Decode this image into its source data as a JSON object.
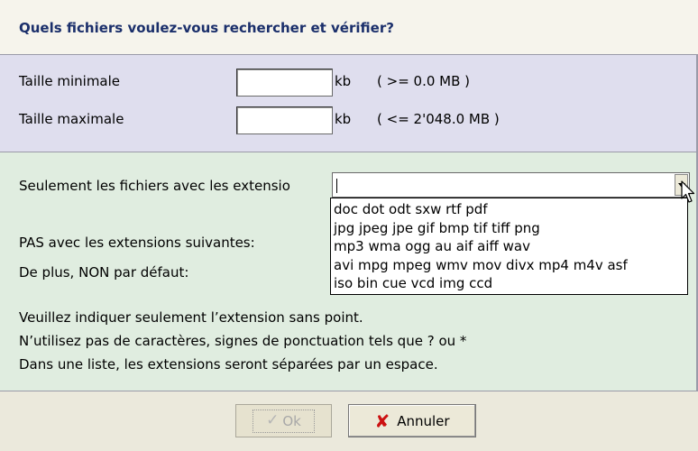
{
  "header": {
    "title": "Quels fichiers voulez-vous rechercher et vérifier?"
  },
  "size": {
    "min_label": "Taille minimale",
    "min_value": "",
    "min_unit": "kb",
    "min_hint": "( >= 0.0 MB )",
    "max_label": "Taille maximale",
    "max_value": "",
    "max_unit": "kb",
    "max_hint": "( <= 2'048.0 MB )"
  },
  "extensions": {
    "only_label": "Seulement les fichiers avec les extensio",
    "only_value": "",
    "not_label": "PAS avec les extensions suivantes:",
    "default_label": "De plus, NON par défaut:",
    "options": [
      "doc dot odt sxw rtf pdf",
      "jpg jpeg jpe gif bmp tif tiff png",
      "mp3 wma ogg au aif aiff wav",
      "avi mpg mpeg wmv mov divx mp4 m4v asf",
      "iso bin cue vcd img ccd"
    ]
  },
  "help": {
    "line1": "Veuillez indiquer seulement l’extension sans point.",
    "line2": "N’utilisez pas de caractères, signes de ponctuation tels que ? ou *",
    "line3": "Dans une liste, les extensions seront séparées par un espace."
  },
  "buttons": {
    "ok": "Ok",
    "cancel": "Annuler"
  },
  "icons": {
    "ok": "check-icon",
    "cancel": "x-icon",
    "cursor": "mouse-pointer-icon"
  }
}
